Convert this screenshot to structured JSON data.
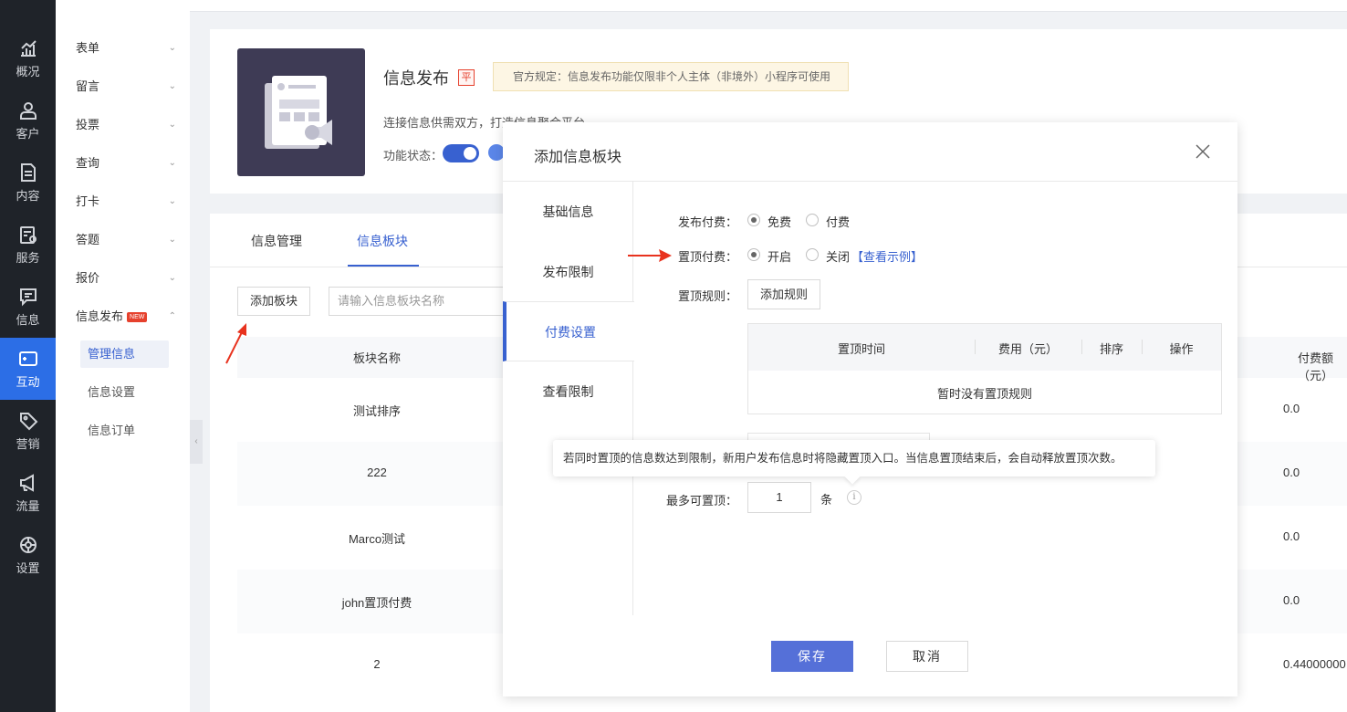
{
  "rail": {
    "items": [
      {
        "label": "概况",
        "icon": "chart-icon"
      },
      {
        "label": "客户",
        "icon": "user-icon"
      },
      {
        "label": "内容",
        "icon": "document-icon"
      },
      {
        "label": "服务",
        "icon": "service-icon"
      },
      {
        "label": "信息",
        "icon": "message-icon"
      },
      {
        "label": "互动",
        "icon": "interaction-icon"
      },
      {
        "label": "营销",
        "icon": "tag-icon"
      },
      {
        "label": "流量",
        "icon": "megaphone-icon"
      },
      {
        "label": "设置",
        "icon": "settings-icon"
      }
    ],
    "active_index": 5,
    "active_color": "#2c6ee6"
  },
  "submenu": {
    "items": [
      "表单",
      "留言",
      "投票",
      "查询",
      "打卡",
      "答题",
      "报价",
      "信息发布"
    ],
    "new_badge": "NEW",
    "children": [
      "管理信息",
      "信息设置",
      "信息订单"
    ]
  },
  "header": {
    "title": "信息发布",
    "badge": "平",
    "notice": "官方规定：信息发布功能仅限非个人主体（非境外）小程序可使用",
    "description": "连接信息供需双方，打造信息聚合平台",
    "status_label": "功能状态："
  },
  "main": {
    "tabs": [
      "信息管理",
      "信息板块"
    ],
    "active_tab": 1,
    "add_block_button": "添加板块",
    "search_placeholder": "请输入信息板块名称",
    "columns": [
      "板块名称",
      "付费额（元）"
    ],
    "rows": [
      {
        "name": "测试排序",
        "fee": "0.0"
      },
      {
        "name": "222",
        "fee": "0.0"
      },
      {
        "name": "Marco测试",
        "fee": "0.0"
      },
      {
        "name": "john置顶付费",
        "fee": "0.0"
      },
      {
        "name": "2",
        "fee": "0.44000000"
      }
    ]
  },
  "modal": {
    "title": "添加信息板块",
    "nav": [
      "基础信息",
      "发布限制",
      "付费设置",
      "查看限制"
    ],
    "active_nav": 2,
    "publish_fee": {
      "label": "发布付费：",
      "options": [
        "免费",
        "付费"
      ],
      "selected": 0
    },
    "top_fee": {
      "label": "置顶付费：",
      "options": [
        "开启",
        "关闭"
      ],
      "selected": 0,
      "example_link": "【查看示例】"
    },
    "top_rule": {
      "label": "置顶规则：",
      "add_button": "添加规则",
      "columns": [
        "置顶时间",
        "费用（元）",
        "排序",
        "操作"
      ],
      "empty_text": "暂时没有置顶规则"
    },
    "tooltip": "若同时置顶的信息数达到限制，新用户发布信息时将隐藏置顶入口。当信息置顶结束后，会自动释放置顶次数。",
    "max_top": {
      "label": "最多可置顶：",
      "value": "1",
      "unit": "条"
    },
    "save_button": "保存",
    "cancel_button": "取消",
    "primary_color": "#5570d8"
  }
}
